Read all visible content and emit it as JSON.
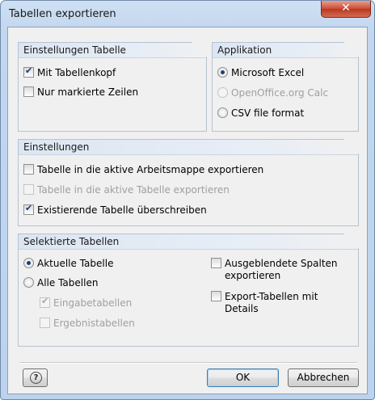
{
  "window": {
    "title": "Tabellen exportieren",
    "close_icon": "close-icon"
  },
  "groups": {
    "tabelle": {
      "title": "Einstellungen Tabelle",
      "options": [
        {
          "label": "Mit Tabellenkopf",
          "checked": true,
          "enabled": true
        },
        {
          "label": "Nur markierte Zeilen",
          "checked": false,
          "enabled": true
        }
      ]
    },
    "applikation": {
      "title": "Applikation",
      "options": [
        {
          "label": "Microsoft Excel",
          "selected": true,
          "enabled": true
        },
        {
          "label": "OpenOffice.org Calc",
          "selected": false,
          "enabled": false
        },
        {
          "label": "CSV file format",
          "selected": false,
          "enabled": true
        }
      ]
    },
    "einstellungen": {
      "title": "Einstellungen",
      "options": [
        {
          "label": "Tabelle in die aktive Arbeitsmappe exportieren",
          "checked": false,
          "enabled": true
        },
        {
          "label": "Tabelle in die aktive Tabelle exportieren",
          "checked": false,
          "enabled": false
        },
        {
          "label": "Existierende Tabelle überschreiben",
          "checked": true,
          "enabled": true
        }
      ]
    },
    "selektierte": {
      "title": "Selektierte Tabellen",
      "radios": [
        {
          "label": "Aktuelle Tabelle",
          "selected": true
        },
        {
          "label": "Alle Tabellen",
          "selected": false
        }
      ],
      "sub_options": [
        {
          "label": "Eingabetabellen",
          "checked": true,
          "enabled": false
        },
        {
          "label": "Ergebnistabellen",
          "checked": false,
          "enabled": false
        }
      ],
      "right_options": [
        {
          "label_line1": "Ausgeblendete Spalten",
          "label_line2": "exportieren",
          "checked": false
        },
        {
          "label_line1": "Export-Tabellen mit",
          "label_line2": "Details",
          "checked": false
        }
      ]
    }
  },
  "buttons": {
    "help_icon": "help-icon",
    "ok": "OK",
    "cancel": "Abbrechen"
  }
}
